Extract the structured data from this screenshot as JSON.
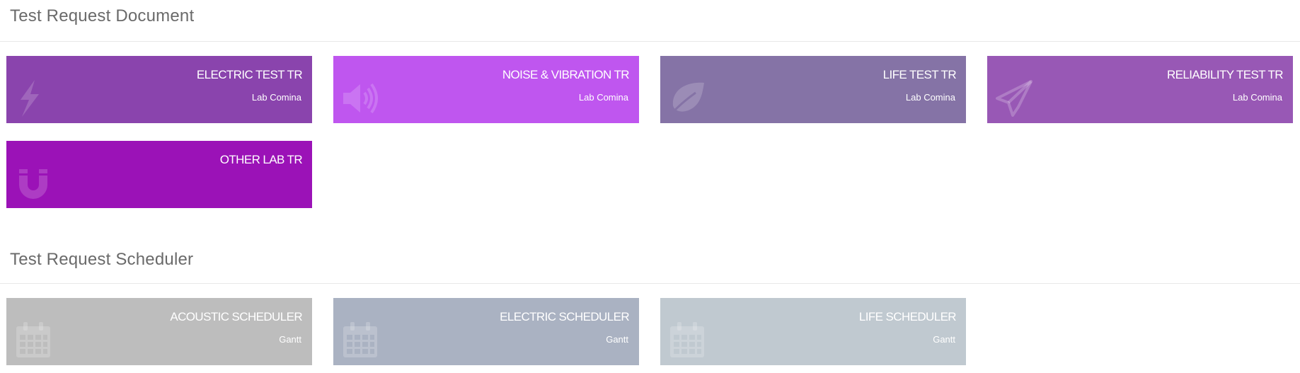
{
  "sections": {
    "document": {
      "title": "Test Request Document",
      "tiles": [
        {
          "title": "ELECTRIC TEST TR",
          "subtitle": "Lab Comina",
          "icon": "lightning-icon",
          "color": "#8a44ad"
        },
        {
          "title": "NOISE & VIBRATION TR",
          "subtitle": "Lab Comina",
          "icon": "speaker-icon",
          "color": "#bf56ef"
        },
        {
          "title": "LIFE TEST TR",
          "subtitle": "Lab Comina",
          "icon": "leaf-icon",
          "color": "#8573a6"
        },
        {
          "title": "RELIABILITY TEST TR",
          "subtitle": "Lab Comina",
          "icon": "paper-plane-icon",
          "color": "#9858b5"
        },
        {
          "title": "OTHER LAB TR",
          "subtitle": "",
          "icon": "magnet-icon",
          "color": "#9b12b7"
        }
      ]
    },
    "scheduler": {
      "title": "Test Request Scheduler",
      "tiles": [
        {
          "title": "ACOUSTIC SCHEDULER",
          "subtitle": "Gantt",
          "icon": "calendar-icon",
          "color": "#bdbdbd"
        },
        {
          "title": "ELECTRIC SCHEDULER",
          "subtitle": "Gantt",
          "icon": "calendar-icon",
          "color": "#aab2c2"
        },
        {
          "title": "LIFE SCHEDULER",
          "subtitle": "Gantt",
          "icon": "calendar-icon",
          "color": "#c0c9d0"
        }
      ]
    }
  }
}
